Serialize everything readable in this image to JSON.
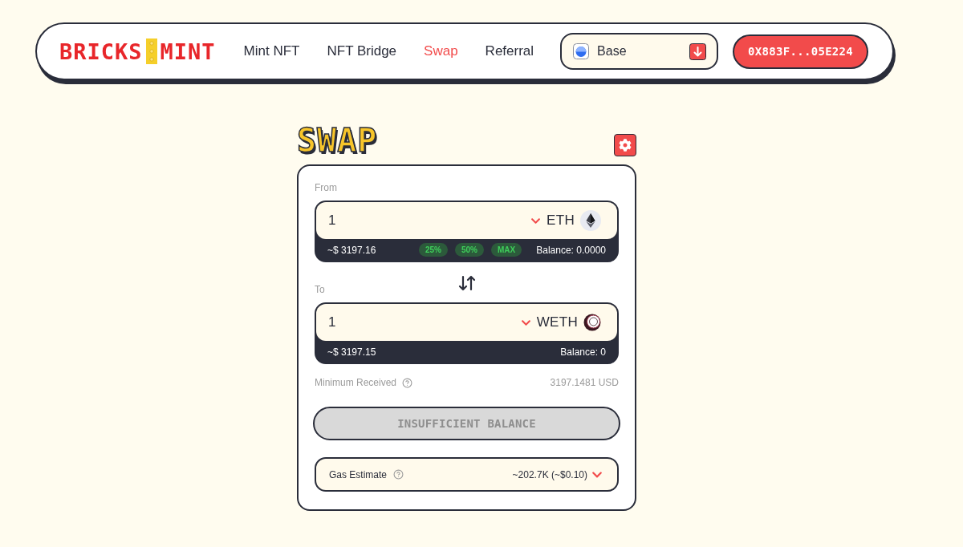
{
  "navbar": {
    "logo": {
      "left": "BRICKS",
      "right": "MINT"
    },
    "links": [
      {
        "label": "Mint NFT",
        "selected": false
      },
      {
        "label": "NFT Bridge",
        "selected": false
      },
      {
        "label": "Swap",
        "selected": true
      },
      {
        "label": "Referral",
        "selected": false
      }
    ],
    "network": {
      "label": "Base"
    },
    "wallet": {
      "label": "0X883F...05E224"
    }
  },
  "swap": {
    "title": "SWAP",
    "from": {
      "label": "From",
      "amount": "1",
      "token": "ETH",
      "usd": "~$ 3197.16",
      "presets": [
        "25%",
        "50%",
        "MAX"
      ],
      "balance": "Balance: 0.0000"
    },
    "to": {
      "label": "To",
      "amount": "1",
      "token": "WETH",
      "usd": "~$ 3197.15",
      "balance": "Balance: 0"
    },
    "minimum": {
      "label": "Minimum Received",
      "value": "3197.1481 USD"
    },
    "action": {
      "label": "INSUFFICIENT BALANCE",
      "disabled": true
    },
    "gas": {
      "label": "Gas Estimate",
      "value": "~202.7K (~$0.10)"
    }
  }
}
